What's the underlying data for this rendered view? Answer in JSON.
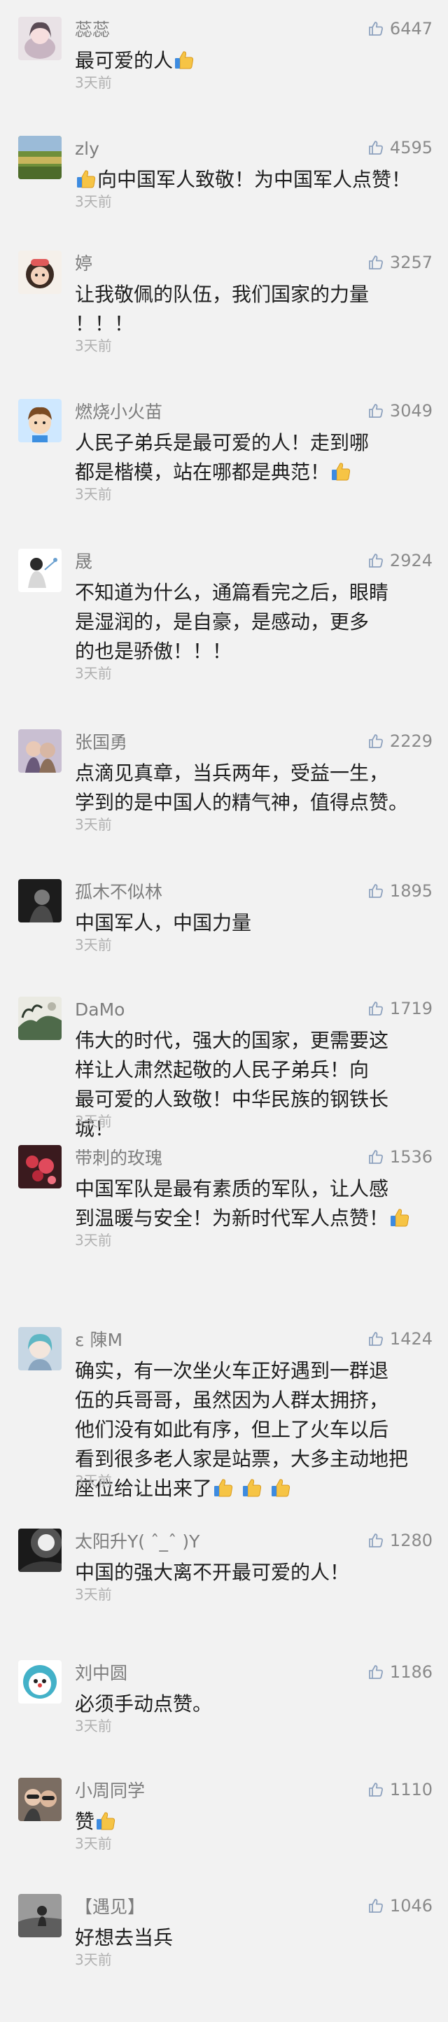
{
  "like_icon_color": "#8fa3bf",
  "comments": [
    {
      "name": "蕊蕊",
      "likes": "6447",
      "text": "最可爱的人",
      "time": "3天前",
      "emoji_after": 1,
      "emoji_before": 0
    },
    {
      "name": "zly",
      "likes": "4595",
      "text": "向中国军人致敬！为中国军人点赞！",
      "time": "3天前",
      "emoji_after": 0,
      "emoji_before": 1
    },
    {
      "name": "婷",
      "likes": "3257",
      "text": "让我敬佩的队伍，我们国家的力量！！！",
      "time": "3天前",
      "emoji_after": 0,
      "emoji_before": 0
    },
    {
      "name": "燃烧小火苗",
      "likes": "3049",
      "text": "人民子弟兵是最可爱的人！走到哪都是楷模，站在哪都是典范！",
      "time": "3天前",
      "emoji_after": 1,
      "emoji_before": 0
    },
    {
      "name": "晟",
      "likes": "2924",
      "text": "不知道为什么，通篇看完之后，眼睛是湿润的，是自豪，是感动，更多的也是骄傲！！！",
      "time": "3天前",
      "emoji_after": 0,
      "emoji_before": 0
    },
    {
      "name": "张国勇",
      "likes": "2229",
      "text": "点滴见真章，当兵两年，受益一生，学到的是中国人的精气神，值得点赞。",
      "time": "3天前",
      "emoji_after": 0,
      "emoji_before": 0
    },
    {
      "name": "孤木不似林",
      "likes": "1895",
      "text": "中国军人，中国力量",
      "time": "3天前",
      "emoji_after": 0,
      "emoji_before": 0
    },
    {
      "name": "DaMo",
      "likes": "1719",
      "text": "伟大的时代，强大的国家，更需要这样让人肃然起敬的人民子弟兵！向最可爱的人致敬！中华民族的钢铁长城！",
      "time": "3天前",
      "emoji_after": 0,
      "emoji_before": 0
    },
    {
      "name": "带刺的玫瑰",
      "likes": "1536",
      "text": "中国军队是最有素质的军队，让人感到温暖与安全！为新时代军人点赞！",
      "time": "3天前",
      "emoji_after": 1,
      "emoji_before": 0
    },
    {
      "name": "ε 陳M⁠",
      "likes": "1424",
      "text": "确实，有一次坐火车正好遇到一群退伍的兵哥哥，虽然因为人群太拥挤，他们没有如此有序，但上了火车以后看到很多老人家是站票，大多主动地把座位给让出来了",
      "time": "3天前",
      "emoji_after": 3,
      "emoji_before": 0
    },
    {
      "name": "太阳升Y( ˆ_ˆ )Y",
      "likes": "1280",
      "text": "中国的强大离不开最可爱的人！",
      "time": "3天前",
      "emoji_after": 0,
      "emoji_before": 0
    },
    {
      "name": "刘中圆",
      "likes": "1186",
      "text": "必须手动点赞。",
      "time": "3天前",
      "emoji_after": 0,
      "emoji_before": 0
    },
    {
      "name": "小周同学",
      "likes": "1110",
      "text": "赞",
      "time": "3天前",
      "emoji_after": 1,
      "emoji_before": 0
    },
    {
      "name": "【遇见】",
      "likes": "1046",
      "text": "好想去当兵",
      "time": "3天前",
      "emoji_after": 0,
      "emoji_before": 0
    }
  ]
}
